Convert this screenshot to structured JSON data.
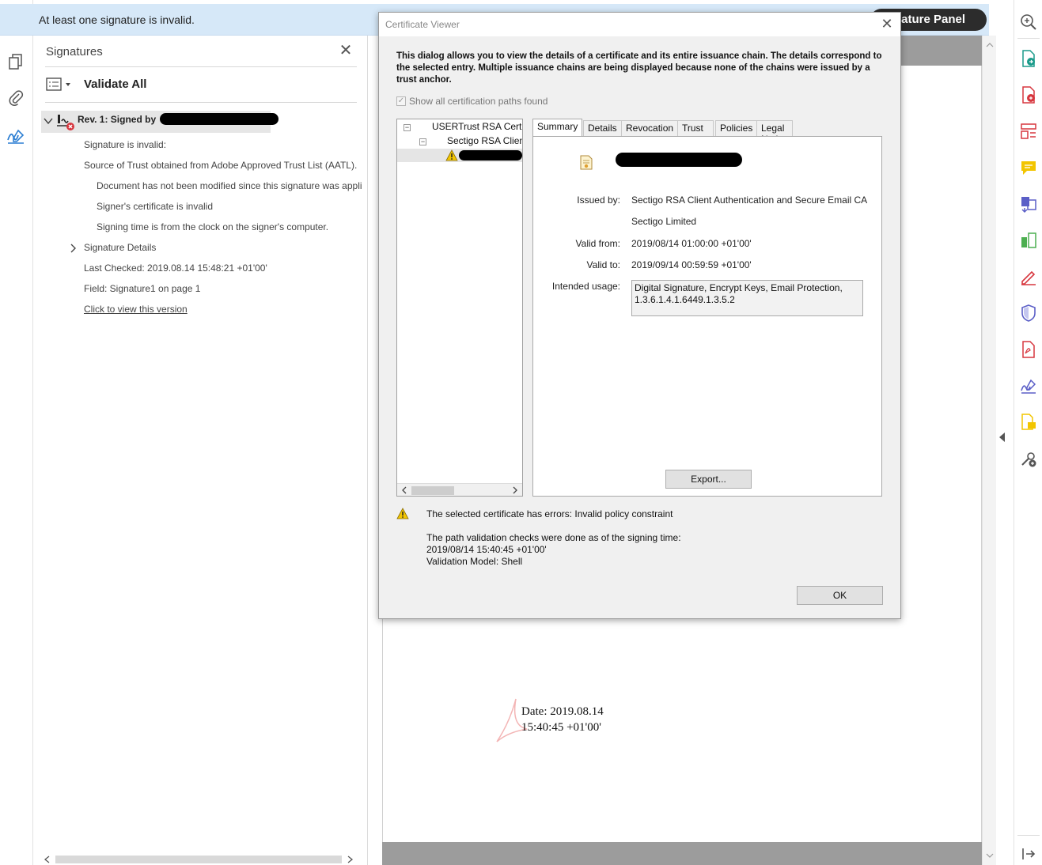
{
  "banner": {
    "message": "At least one signature is invalid.",
    "panel_button": "nature Panel"
  },
  "signatures_pane": {
    "title": "Signatures",
    "validate_all": "Validate All",
    "revision_label": "Rev. 1: Signed by",
    "items": [
      "Signature is invalid:",
      "Source of Trust obtained from Adobe Approved Trust List (AATL).",
      "Document has not been modified since this signature was appli",
      "Signer's certificate is invalid",
      "Signing time is from the clock on the signer's computer.",
      "Signature Details",
      "Last Checked: 2019.08.14 15:48:21 +01'00'",
      "Field: Signature1 on page 1",
      "Click to view this version"
    ]
  },
  "document": {
    "stamp_date_line1": "Date: 2019.08.14",
    "stamp_date_line2": "15:40:45 +01'00'"
  },
  "dialog": {
    "title": "Certificate Viewer",
    "description": "This dialog allows you to view the details of a certificate and its entire issuance chain. The details correspond to the selected entry. Multiple issuance chains are being displayed because none of the chains were issued by a trust anchor.",
    "show_all_label": "Show all certification paths found",
    "chain": {
      "root": "USERTrust RSA Certifi",
      "intermediate": "Sectigo RSA Client"
    },
    "tabs": [
      "Summary",
      "Details",
      "Revocation",
      "Trust",
      "Policies",
      "Legal Notice"
    ],
    "summary": {
      "issued_by_label": "Issued by:",
      "issued_by_value": "Sectigo RSA Client Authentication and Secure Email CA",
      "issuer_org": "Sectigo Limited",
      "valid_from_label": "Valid from:",
      "valid_from_value": "2019/08/14 01:00:00 +01'00'",
      "valid_to_label": "Valid to:",
      "valid_to_value": "2019/09/14 00:59:59 +01'00'",
      "usage_label": "Intended usage:",
      "usage_value": "Digital Signature, Encrypt Keys, Email Protection, 1.3.6.1.4.1.6449.1.3.5.2",
      "export_button": "Export..."
    },
    "error_message": "The selected certificate has errors: Invalid policy constraint",
    "path_line1": "The path validation checks were done as of the signing time:",
    "path_line2": "2019/08/14 15:40:45 +01'00'",
    "path_line3": "Validation Model: Shell",
    "ok_button": "OK"
  },
  "colors": {
    "banner_bg": "#d6e8f8",
    "accent_blue": "#2d7fd3",
    "error_red": "#d7373f",
    "warning_yellow": "#f2c500"
  }
}
